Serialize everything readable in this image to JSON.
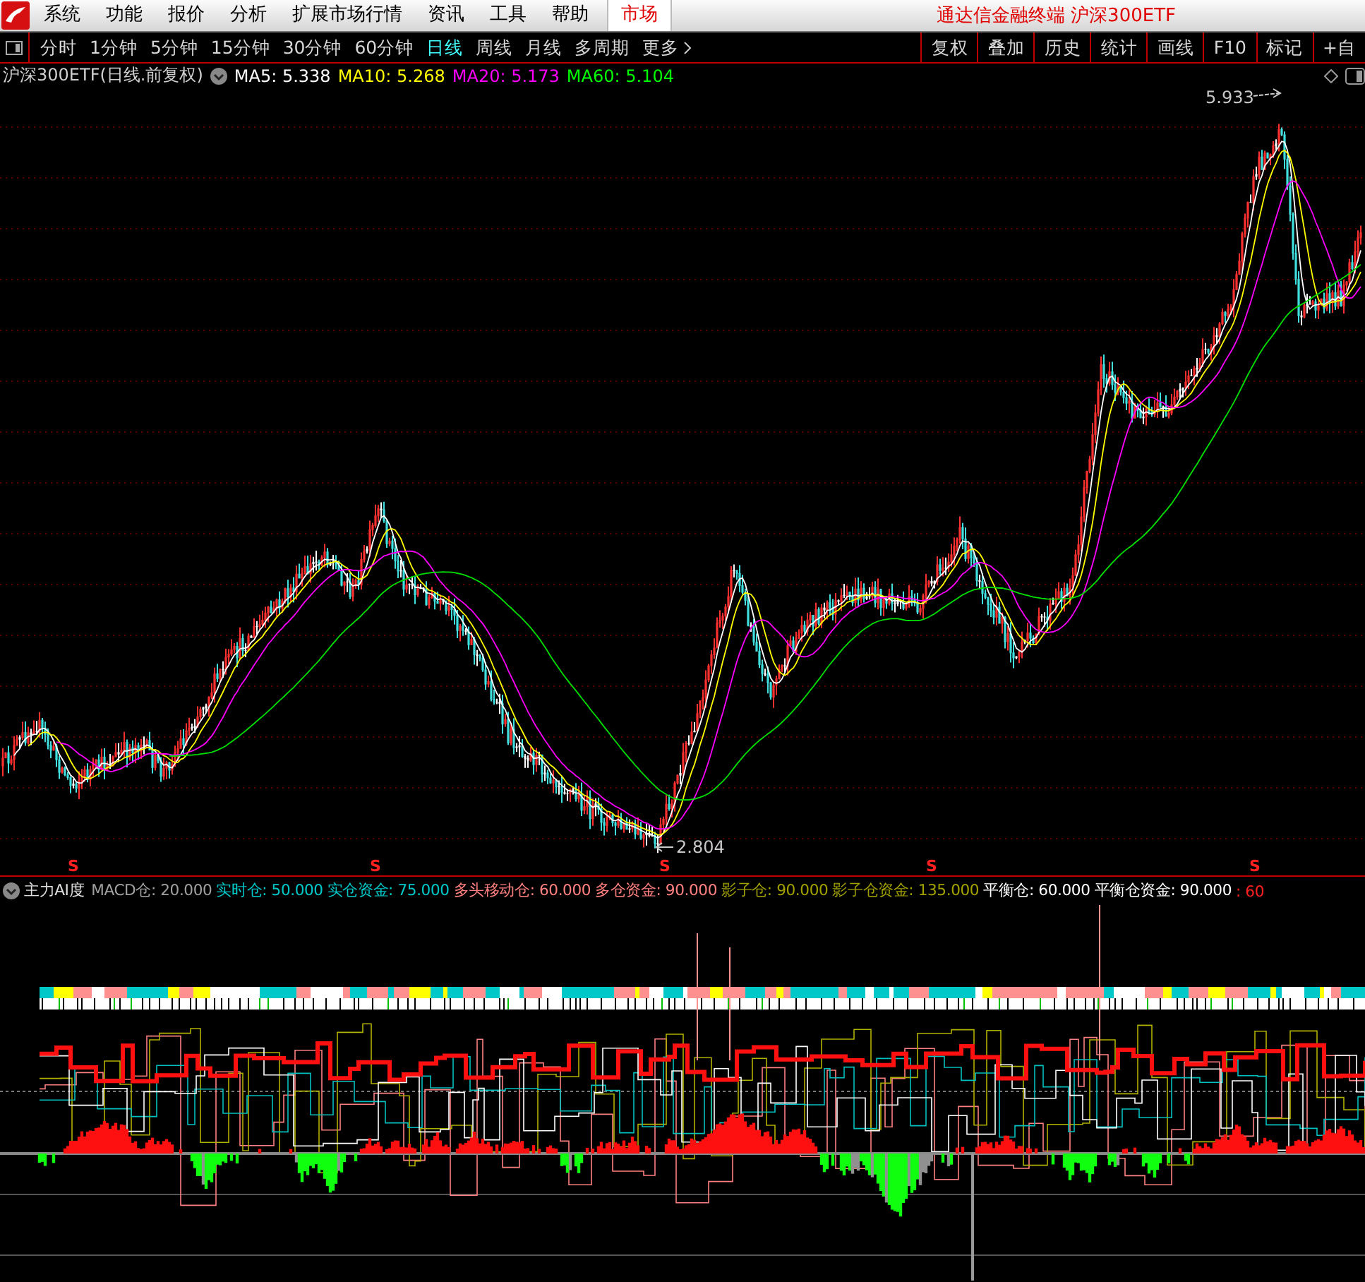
{
  "menu": {
    "items": [
      {
        "label": "系统",
        "selected": false
      },
      {
        "label": "功能",
        "selected": false
      },
      {
        "label": "报价",
        "selected": false
      },
      {
        "label": "分析",
        "selected": false
      },
      {
        "label": "扩展市场行情",
        "selected": false
      },
      {
        "label": "资讯",
        "selected": false
      },
      {
        "label": "工具",
        "selected": false
      },
      {
        "label": "帮助",
        "selected": false
      },
      {
        "label": "市场",
        "selected": true
      }
    ],
    "title": "通达信金融终端  沪深300ETF"
  },
  "periods": [
    {
      "label": "分时",
      "selected": false
    },
    {
      "label": "1分钟",
      "selected": false
    },
    {
      "label": "5分钟",
      "selected": false
    },
    {
      "label": "15分钟",
      "selected": false
    },
    {
      "label": "30分钟",
      "selected": false
    },
    {
      "label": "60分钟",
      "selected": false
    },
    {
      "label": "日线",
      "selected": true
    },
    {
      "label": "周线",
      "selected": false
    },
    {
      "label": "月线",
      "selected": false
    },
    {
      "label": "多周期",
      "selected": false
    },
    {
      "label": "更多",
      "selected": false
    }
  ],
  "toolbar_buttons": [
    "复权",
    "叠加",
    "历史",
    "统计",
    "画线",
    "F10",
    "标记",
    "+自"
  ],
  "chart": {
    "instrument": "沪深300ETF(日线.前复权)",
    "ma": [
      {
        "label": "MA5: 5.338",
        "color": "#ffffff"
      },
      {
        "label": "MA10: 5.268",
        "color": "#ffff00"
      },
      {
        "label": "MA20: 5.173",
        "color": "#ff00ff"
      },
      {
        "label": "MA60: 5.104",
        "color": "#00ff00"
      }
    ],
    "high_label": "5.933",
    "low_label": "2.804"
  },
  "signals": [
    "S",
    "S",
    "S",
    "S",
    "S"
  ],
  "indicator": {
    "name": "主力AI度",
    "values": [
      {
        "label": "MACD仓: 20.000",
        "color": "#a0a0a0"
      },
      {
        "label": "实时仓: 50.000",
        "color": "#00c8c8"
      },
      {
        "label": "实仓资金: 75.000",
        "color": "#00c8c8"
      },
      {
        "label": "多头移动仓: 60.000",
        "color": "#ff8080"
      },
      {
        "label": "多仓资金: 90.000",
        "color": "#ff8080"
      },
      {
        "label": "影子仓: 90.000",
        "color": "#a0a000"
      },
      {
        "label": "影子仓资金: 135.000",
        "color": "#a0a000"
      },
      {
        "label": "平衡仓: 60.000",
        "color": "#ffffff"
      },
      {
        "label": "平衡仓资金: 90.000",
        "color": "#ffffff"
      },
      {
        "label": ": 60",
        "color": "#ff2020"
      }
    ]
  }
}
